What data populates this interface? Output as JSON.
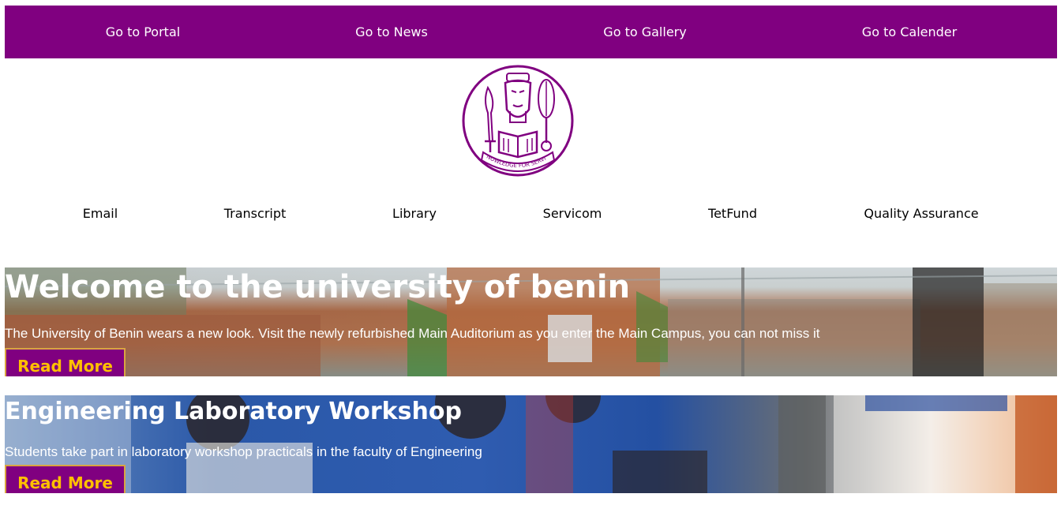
{
  "colors": {
    "brand_purple": "#800080",
    "button_text": "#ffc000",
    "button_border": "#d9a441"
  },
  "top_nav": {
    "items": [
      {
        "label": "Go to Portal"
      },
      {
        "label": "Go to News"
      },
      {
        "label": "Go to Gallery"
      },
      {
        "label": "Go to Calender"
      }
    ]
  },
  "logo": {
    "icon": "university-crest-icon",
    "motto": "KNOWLEDGE FOR SERVICE"
  },
  "quick_links": {
    "items": [
      {
        "label": "Email"
      },
      {
        "label": "Transcript"
      },
      {
        "label": "Library"
      },
      {
        "label": "Servicom"
      },
      {
        "label": "TetFund"
      },
      {
        "label": "Quality Assurance"
      }
    ]
  },
  "slides": [
    {
      "title": "Welcome to the university of benin",
      "text": "The University of Benin wears a new look. Visit the newly refurbished Main Auditorium as you enter the Main Campus, you can not miss it",
      "button_label": "Read More"
    },
    {
      "title": "Engineering Laboratory Workshop",
      "text": "Students take part in laboratory workshop practicals in the faculty of Engineering",
      "button_label": "Read More"
    }
  ]
}
